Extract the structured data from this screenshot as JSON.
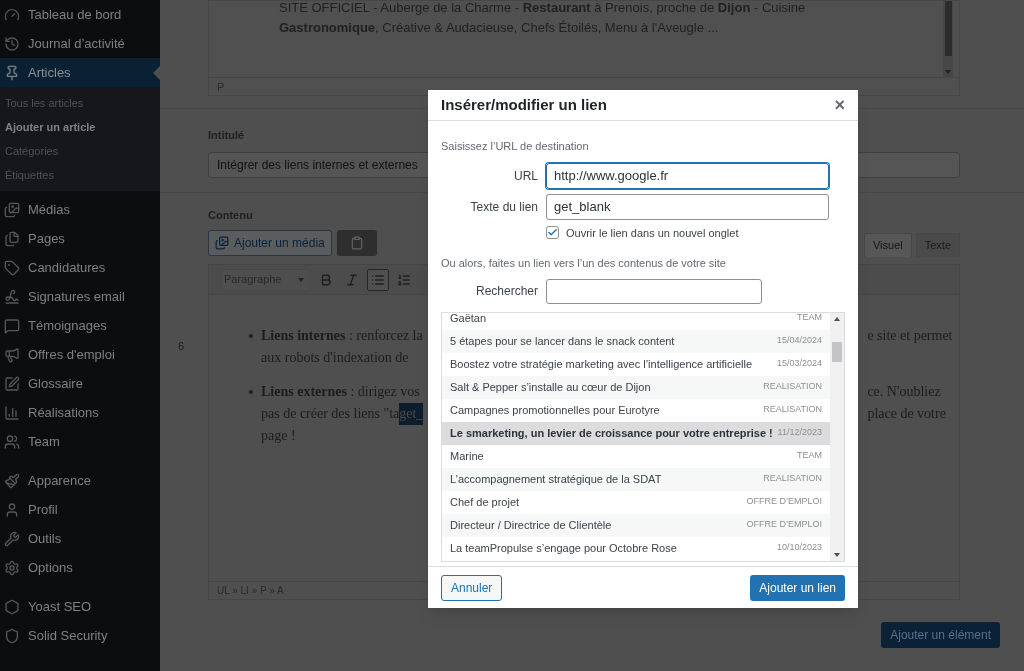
{
  "sidebar": {
    "items": [
      {
        "label": "Tableau de bord",
        "selected": false
      },
      {
        "label": "Journal d’activité",
        "selected": false
      },
      {
        "label": "Articles",
        "selected": true,
        "children": [
          {
            "label": "Tous les articles",
            "selected": false
          },
          {
            "label": "Ajouter un article",
            "selected": true
          },
          {
            "label": "Catégories",
            "selected": false
          },
          {
            "label": "Étiquettes",
            "selected": false
          }
        ]
      },
      {
        "label": "Médias",
        "selected": false
      },
      {
        "label": "Pages",
        "selected": false
      },
      {
        "label": "Candidatures",
        "selected": false
      },
      {
        "label": "Signatures email",
        "selected": false
      },
      {
        "label": "Témoignages",
        "selected": false
      },
      {
        "label": "Offres d'emploi",
        "selected": false
      },
      {
        "label": "Glossaire",
        "selected": false
      },
      {
        "label": "Réalisations",
        "selected": false
      },
      {
        "label": "Team",
        "selected": false
      },
      {
        "label": "Apparence",
        "selected": false
      },
      {
        "label": "Profil",
        "selected": false
      },
      {
        "label": "Outils",
        "selected": false
      },
      {
        "label": "Options",
        "selected": false
      },
      {
        "label": "Yoast SEO",
        "selected": false
      },
      {
        "label": "Solid Security",
        "selected": false
      }
    ]
  },
  "excerpt": {
    "lines": [
      "SITE OFFICIEL - Auberge de la Charme - **Restaurant** à Prenois, proche de **Dijon** - Cuisine",
      "**Gastronomique**, Créative & Audacieuse, Chefs Étoilés, Menu à l'Aveugle ..."
    ],
    "path": "P"
  },
  "title_field": {
    "label": "Intitulé",
    "value": "Intégrer des liens internes et externes"
  },
  "content": {
    "label": "Contenu",
    "media_button": "Ajouter un média",
    "tabs": [
      {
        "label": "Visuel",
        "selected": true
      },
      {
        "label": "Texte",
        "selected": false
      }
    ],
    "format": "Paragraphe",
    "toolbar": [
      {
        "active": false
      },
      {
        "active": false
      },
      {
        "active": true
      },
      {
        "active": false
      }
    ],
    "line_number": "6",
    "left_lines": [
      [
        "**Liens internes** : renforcez la",
        "aux robots d'indexation de"
      ],
      [
        "**Liens externes** : dirigez vos",
        "pas de créer des liens \"ta",
        "page !"
      ]
    ],
    "highlight": "get_",
    "right_lines": [
      "e site et permet",
      "ce. N'oubliez",
      "place de votre"
    ],
    "path": "UL » LI » P » A"
  },
  "add_button": "Ajouter un élément",
  "dialog": {
    "title": "Insérer/modifier un lien",
    "close": "×",
    "intro": "Saisissez l’URL de destination",
    "url": {
      "label": "URL",
      "value": "http://www.google.fr"
    },
    "link_text": {
      "label": "Texte du lien",
      "value": "get_blank"
    },
    "new_tab": {
      "label": "Ouvrir le lien dans un nouvel onglet",
      "checked": true
    },
    "search_intro": "Ou alors, faites un lien vers l’un des contenus de votre site",
    "search": {
      "label": "Rechercher"
    },
    "results": [
      {
        "title": "Gaëtan",
        "info": "TEAM",
        "selected": false
      },
      {
        "title": "5 étapes pour se lancer dans le snack content",
        "info": "15/04/2024",
        "selected": false
      },
      {
        "title": "Boostez votre stratégie marketing avec l’intelligence artificielle",
        "info": "15/03/2024",
        "selected": false
      },
      {
        "title": "Salt & Pepper s’installe au cœur de Dijon",
        "info": "REALISATION",
        "selected": false
      },
      {
        "title": "Campagnes promotionnelles pour Eurotyre",
        "info": "REALISATION",
        "selected": false
      },
      {
        "title": "Le smarketing, un levier de croissance pour votre entreprise !",
        "info": "11/12/2023",
        "selected": true
      },
      {
        "title": "Marine",
        "info": "TEAM",
        "selected": false
      },
      {
        "title": "L’accompagnement stratégique de la SDAT",
        "info": "REALISATION",
        "selected": false
      },
      {
        "title": "Chef de projet",
        "info": "OFFRE D’EMPLOI",
        "selected": false
      },
      {
        "title": "Directeur / Directrice de Clientèle",
        "info": "OFFRE D’EMPLOI",
        "selected": false
      },
      {
        "title": "La teamPropulse s’engage pour Octobre Rose",
        "info": "10/10/2023",
        "selected": false
      }
    ],
    "cancel": "Annuler",
    "submit": "Ajouter un lien"
  }
}
